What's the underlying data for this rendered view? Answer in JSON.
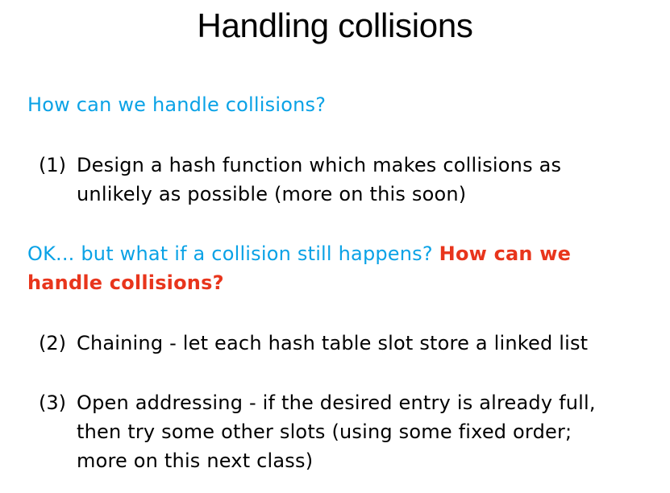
{
  "slide": {
    "title": "Handling collisions",
    "question": "How can we handle collisions?",
    "item1": {
      "number": "(1)",
      "line1": "Design a hash function which makes collisions as",
      "line2": "unlikely as possible (more on this soon)"
    },
    "followup": {
      "blue_text": "OK... but what if a collision still happens?",
      "red_text_part1": "How can we",
      "red_text_part2": "handle collisions?"
    },
    "item2": {
      "number": "(2)",
      "line1": "Chaining - let each hash table slot store a linked list"
    },
    "item3": {
      "number": "(3)",
      "line1": "Open addressing - if the desired entry is already full,",
      "line2": "then try some other slots (using some fixed order;",
      "line3": "more on this next class)"
    },
    "colors": {
      "blue": "#0aa2e6",
      "red": "#e8351c",
      "text": "#000000"
    }
  }
}
